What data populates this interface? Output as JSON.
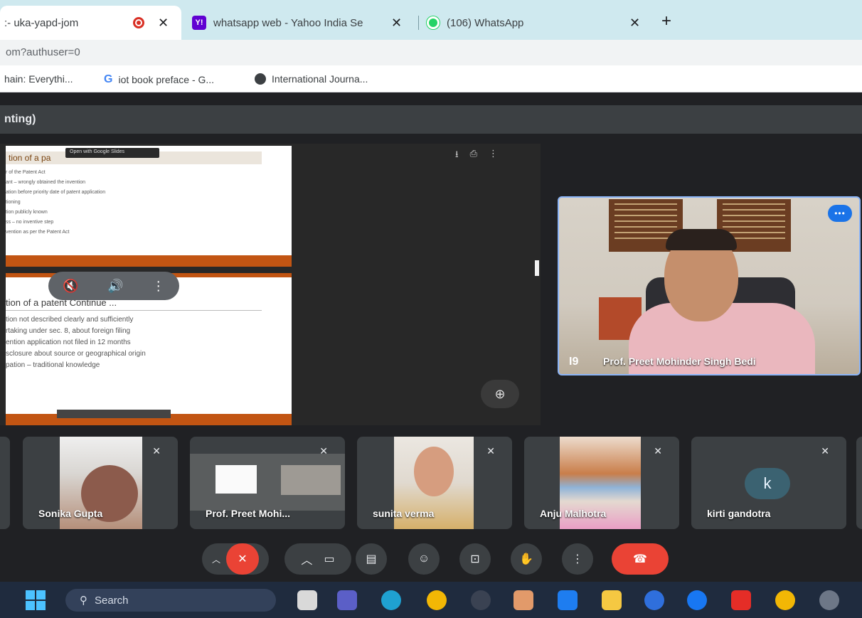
{
  "browser": {
    "tabs": [
      {
        "title": ":- uka-yapd-jom",
        "close": "✕"
      },
      {
        "title": "whatsapp web - Yahoo India Se",
        "close": "✕",
        "favicon": "Y!"
      },
      {
        "title": "(106) WhatsApp",
        "close": "✕"
      }
    ],
    "new_tab": "+",
    "url": "om?authuser=0",
    "bookmarks": [
      {
        "label": "hain: Everythi...",
        "icon": "bookmark-icon"
      },
      {
        "label": "iot book preface - G...",
        "icon": "google-icon",
        "glyph": "G"
      },
      {
        "label": "International Journa...",
        "icon": "globe-icon"
      }
    ]
  },
  "meeting": {
    "title": "nting)",
    "slide1": {
      "heading": "tion of a pa",
      "open_with": "Open with Google Slides",
      "lines": [
        "r of the Patent Act",
        "ant – wrongly obtained the invention",
        "ation before priority date of patent application",
        "tioning",
        "tion publicly known",
        "ss – no inventive step",
        "vention as per the Patent Act"
      ]
    },
    "slide2": {
      "heading": "tion of a patent Continue ...",
      "lines": [
        "tion not described clearly and sufficiently",
        "rtaking under sec. 8, about foreign filing",
        "ention application not filed in 12 months",
        "sclosure about source or geographical origin",
        "pation – traditional knowledge"
      ]
    },
    "speaker": {
      "name": "Prof. Preet Mohinder Singh Bedi",
      "pin": "I9"
    },
    "participants": [
      {
        "name": "Sonika Gupta"
      },
      {
        "name": "Prof. Preet Mohi..."
      },
      {
        "name": "sunita verma"
      },
      {
        "name": "Anju Malhotra"
      },
      {
        "name": "kirti gandotra",
        "initial": "k"
      }
    ]
  },
  "taskbar": {
    "search": "Search"
  },
  "colors": {
    "accent": "#1a73e8",
    "danger": "#ea4335",
    "tab_strip": "#cfe9ef",
    "slide_bar": "#c25513"
  }
}
